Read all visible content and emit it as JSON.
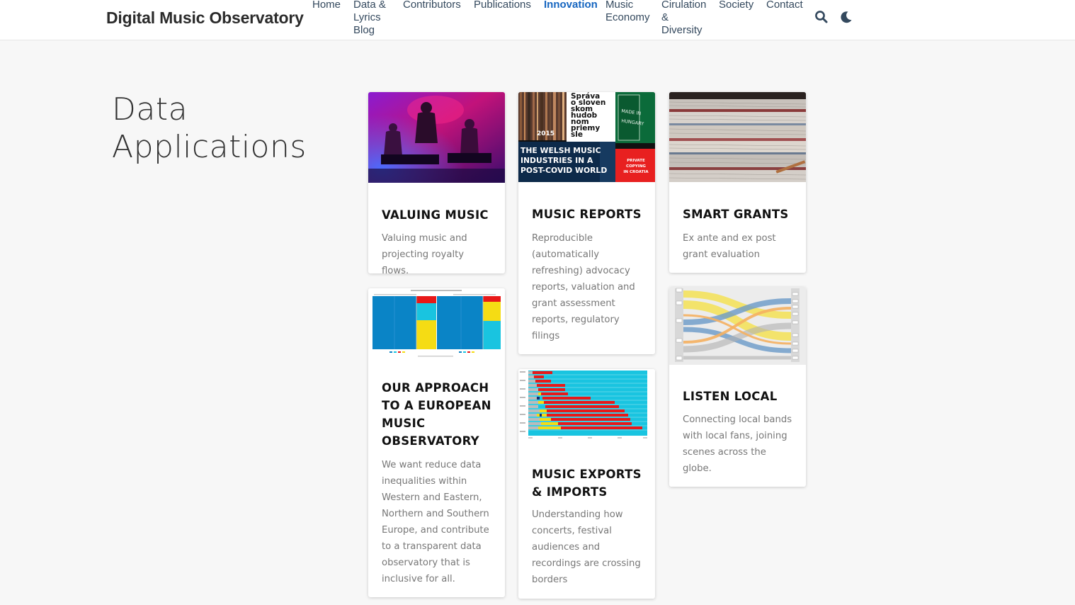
{
  "navbar": {
    "brand": "Digital Music Observatory",
    "items": [
      {
        "label": "Home"
      },
      {
        "label": "Data & Lyrics Blog",
        "lines": [
          "Data &",
          "Lyrics",
          "Blog"
        ]
      },
      {
        "label": "Contributors"
      },
      {
        "label": "Publications"
      },
      {
        "label": "Innovation",
        "active": true
      },
      {
        "label": "Music Economy",
        "lines": [
          "Music",
          "Economy"
        ]
      },
      {
        "label": "Cirulation & Diversity",
        "lines": [
          "Cirulation",
          "&",
          "Diversity"
        ]
      },
      {
        "label": "Society"
      },
      {
        "label": "Contact"
      }
    ],
    "icons": [
      "search-icon",
      "moon-icon"
    ]
  },
  "section": {
    "title_line1": "Data",
    "title_line2": "Applications"
  },
  "cards": [
    {
      "title": "VALUING MUSIC",
      "text": "Valuing music and projecting royalty flows."
    },
    {
      "title": "MUSIC REPORTS",
      "text": "Reproducible (automatically refreshing) advocacy reports, valuation and grant assessment reports, regulatory filings"
    },
    {
      "title": "SMART GRANTS",
      "text": "Ex ante and ex post grant evaluation"
    },
    {
      "title": "OUR APPROACH TO A EUROPEAN MUSIC OBSERVATORY",
      "text": "We want reduce data inequalities within Western and Eastern, Northern and Southern Europe, and contribute to a transparent data observatory that is inclusive for all."
    },
    {
      "title": "MUSIC EXPORTS & IMPORTS",
      "text": "Understanding how concerts, festival audiences and recordings are crossing borders"
    },
    {
      "title": "LISTEN LOCAL",
      "text": "Connecting local bands with local fans, joining scenes across the globe."
    }
  ],
  "images": {
    "music_reports": {
      "year": "2015",
      "slovak_lines": [
        "Správa",
        "o sloven",
        "skom",
        "hudob",
        "nom",
        "priemy",
        "sle"
      ],
      "made_in": [
        "MADE IN",
        "HUNGARY"
      ],
      "welsh_lines": [
        "THE WELSH MUSIC",
        "INDUSTRIES IN A",
        "POST-COVID WORLD"
      ],
      "croatia_lines": [
        "PRIVATE",
        "COPYING",
        "IN CROATIA"
      ]
    }
  },
  "colors": {
    "accent": "#1565c0",
    "nav_text": "#34495e",
    "card_text": "#777777"
  }
}
